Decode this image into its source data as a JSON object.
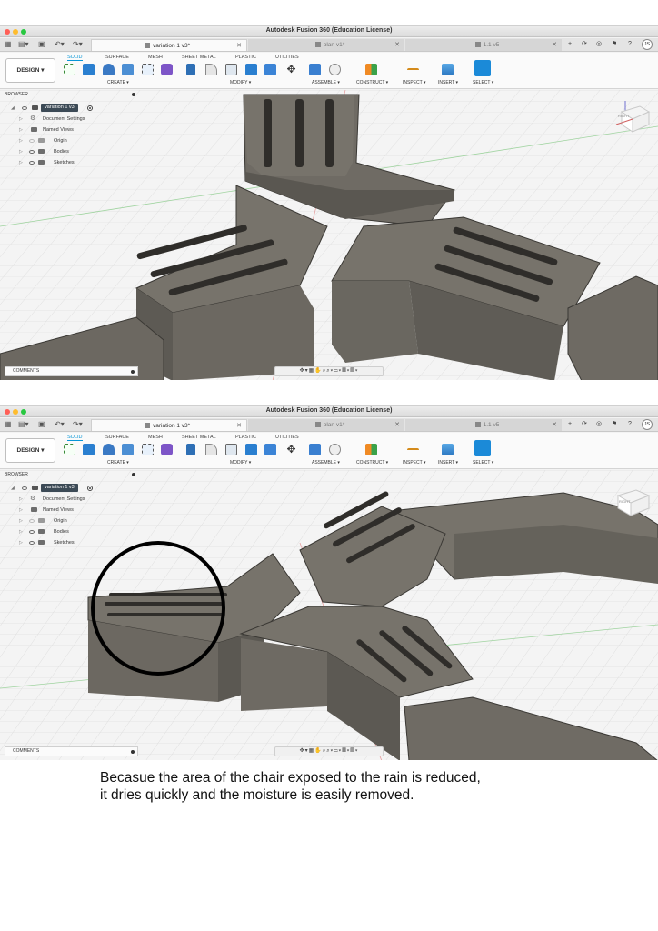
{
  "app": {
    "window_title": "Autodesk Fusion 360 (Education License)",
    "design_button": "DESIGN ▾",
    "user_initials": "JS"
  },
  "tabs": [
    {
      "label": "variation 1 v3*",
      "active": true
    },
    {
      "label": "plan v1*",
      "active": false
    },
    {
      "label": "1.1 v5",
      "active": false
    }
  ],
  "workspace_tabs": [
    "SOLID",
    "SURFACE",
    "MESH",
    "SHEET METAL",
    "PLASTIC",
    "UTILITIES"
  ],
  "tool_groups": [
    "CREATE ▾",
    "MODIFY ▾",
    "ASSEMBLE ▾",
    "CONSTRUCT ▾",
    "INSPECT ▾",
    "INSERT ▾",
    "SELECT ▾"
  ],
  "browser": {
    "header": "BROWSER",
    "root": "variation 1 v3",
    "items": [
      "Document Settings",
      "Named Views",
      "Origin",
      "Bodies",
      "Sketches"
    ]
  },
  "comments_label": "COMMENTS",
  "viewcube_label": "RIGHT",
  "caption": {
    "line1": "Becasue the area of the chair exposed to the rain is reduced,",
    "line2": "it dries quickly and the moisture is easily removed."
  },
  "colors": {
    "accent": "#0696d7",
    "model_fill": "#6e6a63",
    "model_dark": "#56534d",
    "grid": "#dcdcdc",
    "highlight_circle": "#000000"
  },
  "icons": [
    "grid-icon",
    "file-icon",
    "save-icon",
    "undo-icon",
    "redo-icon",
    "close-icon",
    "plus-icon",
    "refresh-icon",
    "notification-icon",
    "job-status-icon",
    "help-icon"
  ]
}
